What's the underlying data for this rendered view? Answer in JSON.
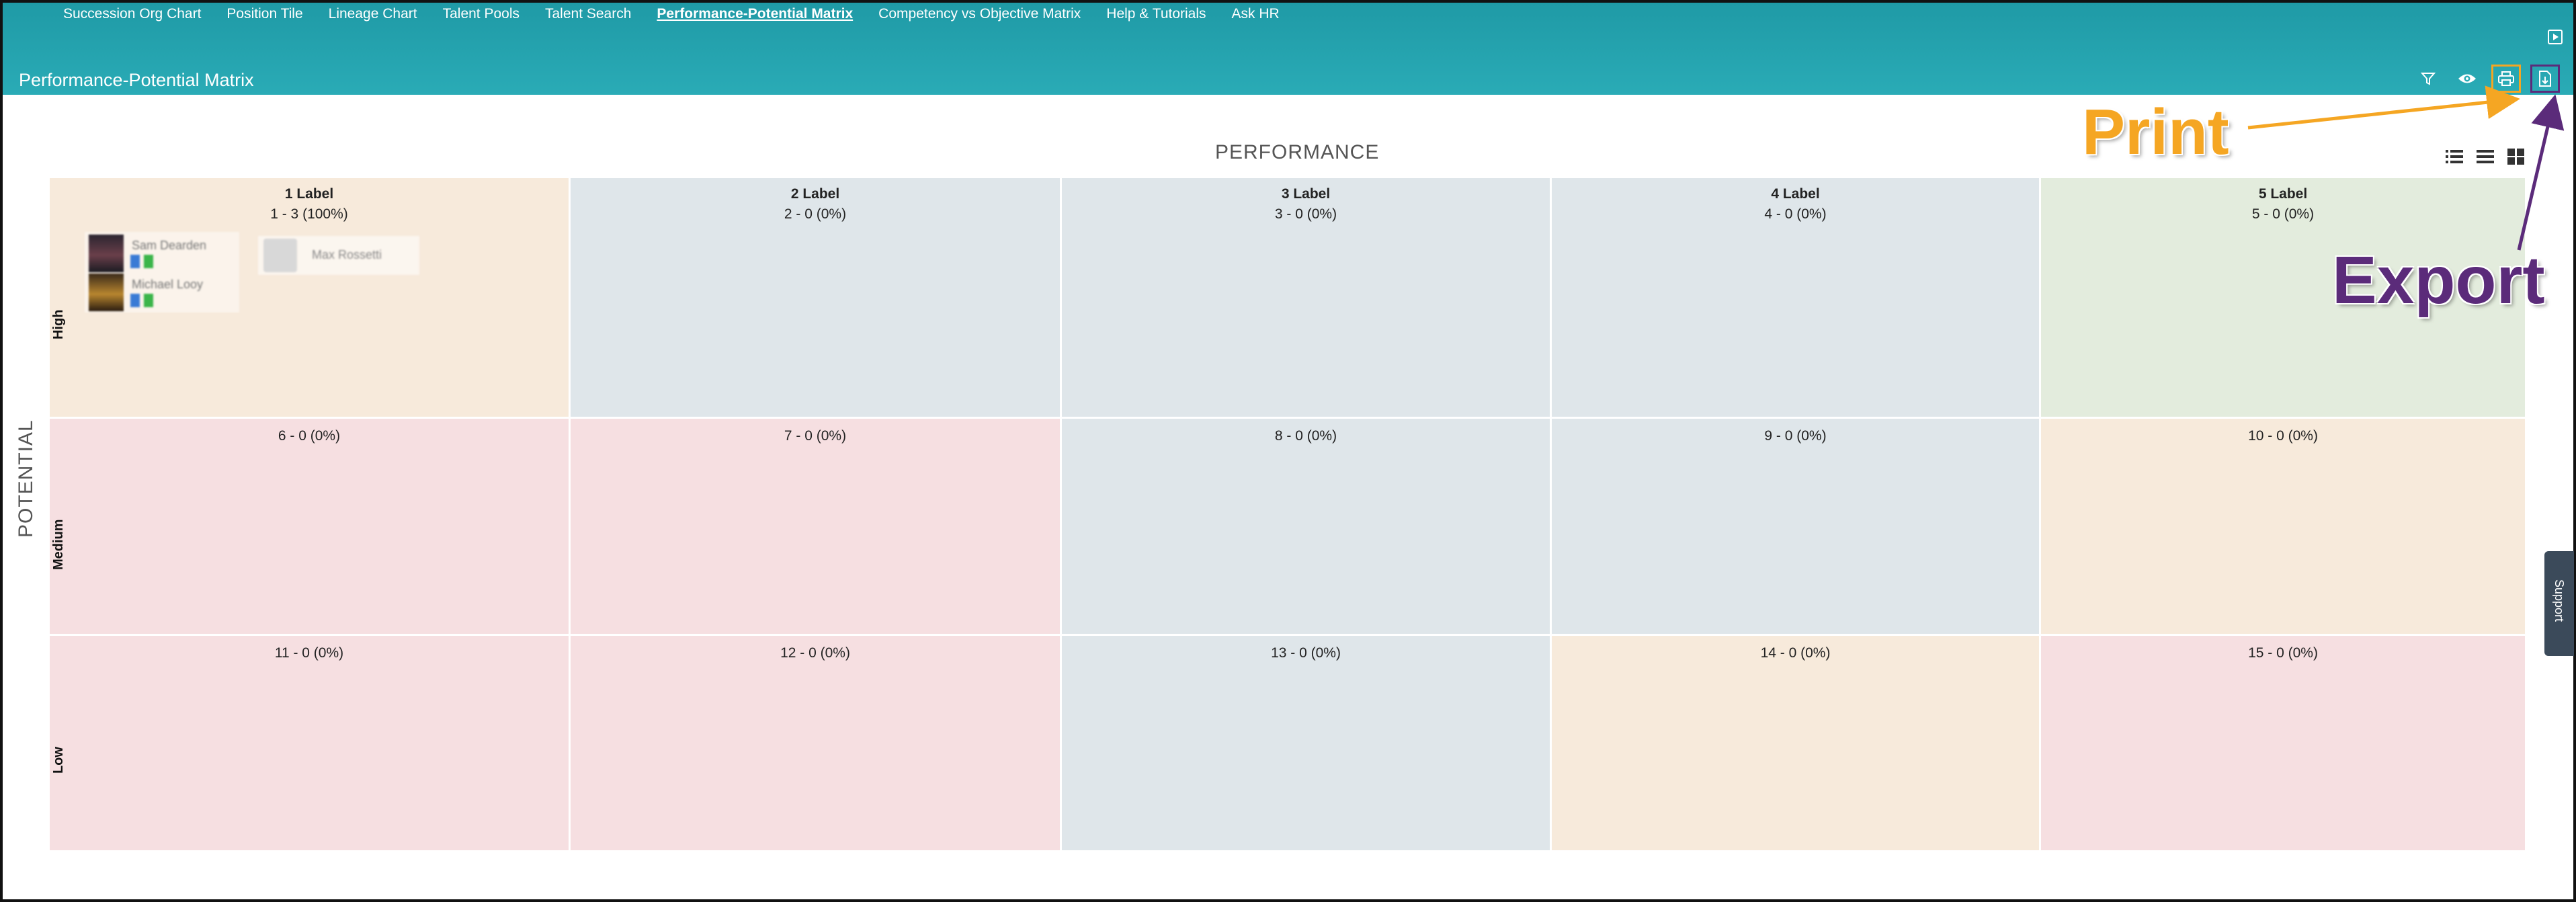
{
  "nav": {
    "items": [
      {
        "label": "Succession Org Chart",
        "active": false
      },
      {
        "label": "Position Tile",
        "active": false
      },
      {
        "label": "Lineage Chart",
        "active": false
      },
      {
        "label": "Talent Pools",
        "active": false
      },
      {
        "label": "Talent Search",
        "active": false
      },
      {
        "label": "Performance-Potential Matrix",
        "active": true
      },
      {
        "label": "Competency vs Objective Matrix",
        "active": false
      },
      {
        "label": "Help & Tutorials",
        "active": false
      },
      {
        "label": "Ask HR",
        "active": false
      }
    ]
  },
  "header": {
    "title": "Performance-Potential Matrix",
    "toolbar": [
      "filter-icon",
      "eye-icon",
      "print-icon",
      "export-icon"
    ]
  },
  "matrix": {
    "x_axis_label": "PERFORMANCE",
    "y_axis_label": "POTENTIAL",
    "columns": [
      "1 Label",
      "2 Label",
      "3 Label",
      "4 Label",
      "5 Label"
    ],
    "rows": [
      "High",
      "Medium",
      "Low"
    ],
    "cells": [
      [
        "1 - 3 (100%)",
        "2 - 0 (0%)",
        "3 - 0 (0%)",
        "4 - 0 (0%)",
        "5 - 0 (0%)"
      ],
      [
        "6 - 0 (0%)",
        "7 - 0 (0%)",
        "8 - 0 (0%)",
        "9 - 0 (0%)",
        "10 - 0 (0%)"
      ],
      [
        "11 - 0 (0%)",
        "12 - 0 (0%)",
        "13 - 0 (0%)",
        "14 - 0 (0%)",
        "15 - 0 (0%)"
      ]
    ],
    "employees_cell1": [
      "Sam Dearden",
      "Michael Looy",
      "Max Rossetti"
    ]
  },
  "annotations": {
    "print": "Print",
    "export": "Export"
  },
  "support": "Support",
  "colors": {
    "banner": "#2aabb6",
    "peach": "#f7eadb",
    "blue": "#dfe6ea",
    "green": "#e3ecdd",
    "pink": "#f6dfe1",
    "print_annotation": "#f5a623",
    "export_annotation": "#5b2b7a"
  }
}
